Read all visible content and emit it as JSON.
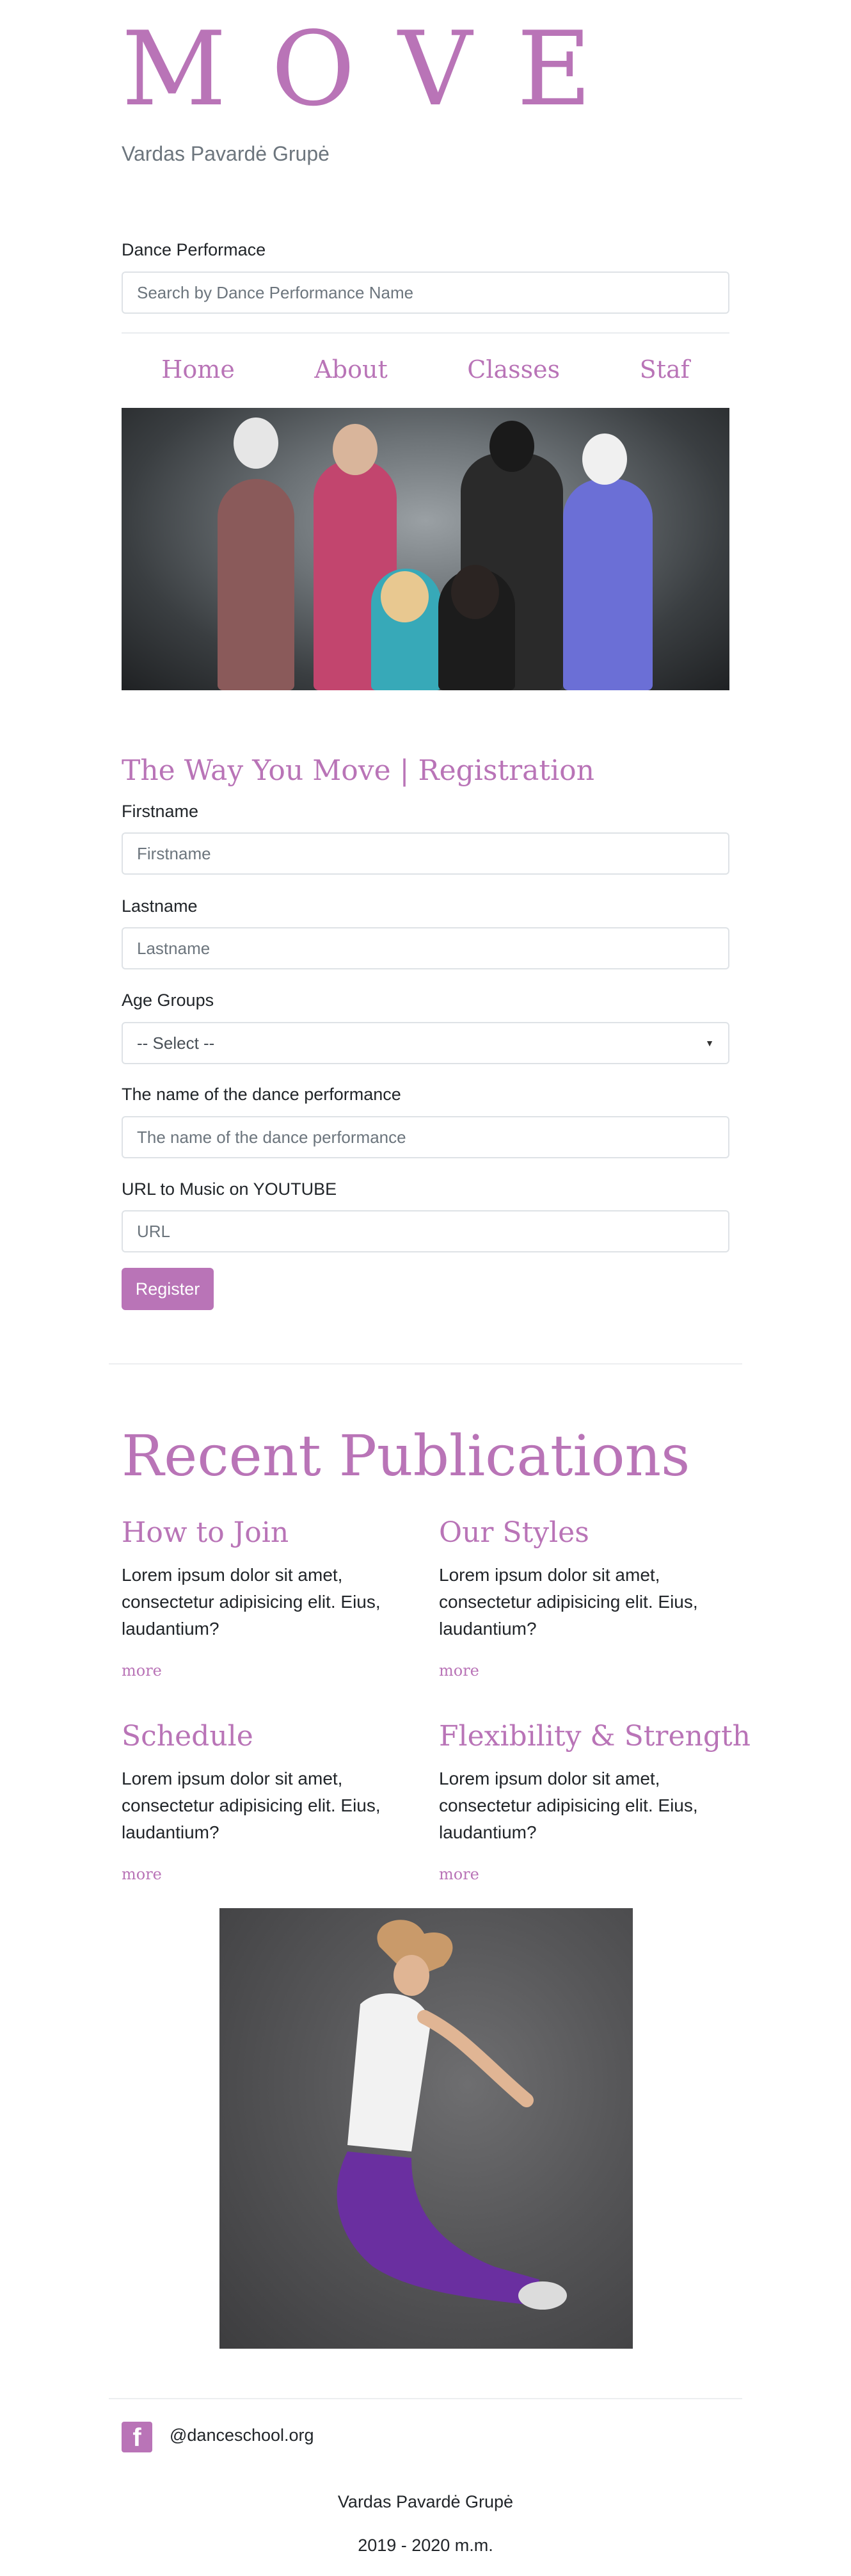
{
  "brand": {
    "logo": "MOVE",
    "subtitle": "Vardas Pavardė Grupė"
  },
  "search": {
    "label": "Dance Performace",
    "placeholder": "Search by Dance Performance Name"
  },
  "nav": {
    "items": [
      {
        "label": "Home"
      },
      {
        "label": "About"
      },
      {
        "label": "Classes"
      },
      {
        "label": "Staf"
      }
    ]
  },
  "registration": {
    "title": "The Way You Move | Registration",
    "firstname": {
      "label": "Firstname",
      "placeholder": "Firstname"
    },
    "lastname": {
      "label": "Lastname",
      "placeholder": "Lastname"
    },
    "age_groups": {
      "label": "Age Groups",
      "selected": "-- Select --"
    },
    "performance": {
      "label": "The name of the dance performance",
      "placeholder": "The name of the dance performance"
    },
    "music": {
      "label": "URL to Music on YOUTUBE",
      "placeholder": "URL"
    },
    "submit_label": "Register"
  },
  "publications": {
    "title": "Recent Publications",
    "items": [
      {
        "title": "How to Join",
        "text": "Lorem ipsum dolor sit amet, consectetur adipisicing elit. Eius, laudantium?",
        "link": "more"
      },
      {
        "title": "Our Styles",
        "text": "Lorem ipsum dolor sit amet, consectetur adipisicing elit. Eius, laudantium?",
        "link": "more"
      },
      {
        "title": "Schedule",
        "text": "Lorem ipsum dolor sit amet, consectetur adipisicing elit. Eius, laudantium?",
        "link": "more"
      },
      {
        "title": "Flexibility & Strength",
        "text": "Lorem ipsum dolor sit amet, consectetur adipisicing elit. Eius, laudantium?",
        "link": "more"
      }
    ]
  },
  "footer": {
    "social_handle": "@danceschool.org",
    "credit": "Vardas Pavardė Grupė",
    "years": "2019 - 2020 m.m."
  },
  "colors": {
    "accent": "#b974b7",
    "text": "#212529",
    "muted": "#6c757d",
    "border": "#dee2e6"
  },
  "icons": {
    "social": "facebook-icon",
    "select_caret": "caret-down-icon"
  }
}
